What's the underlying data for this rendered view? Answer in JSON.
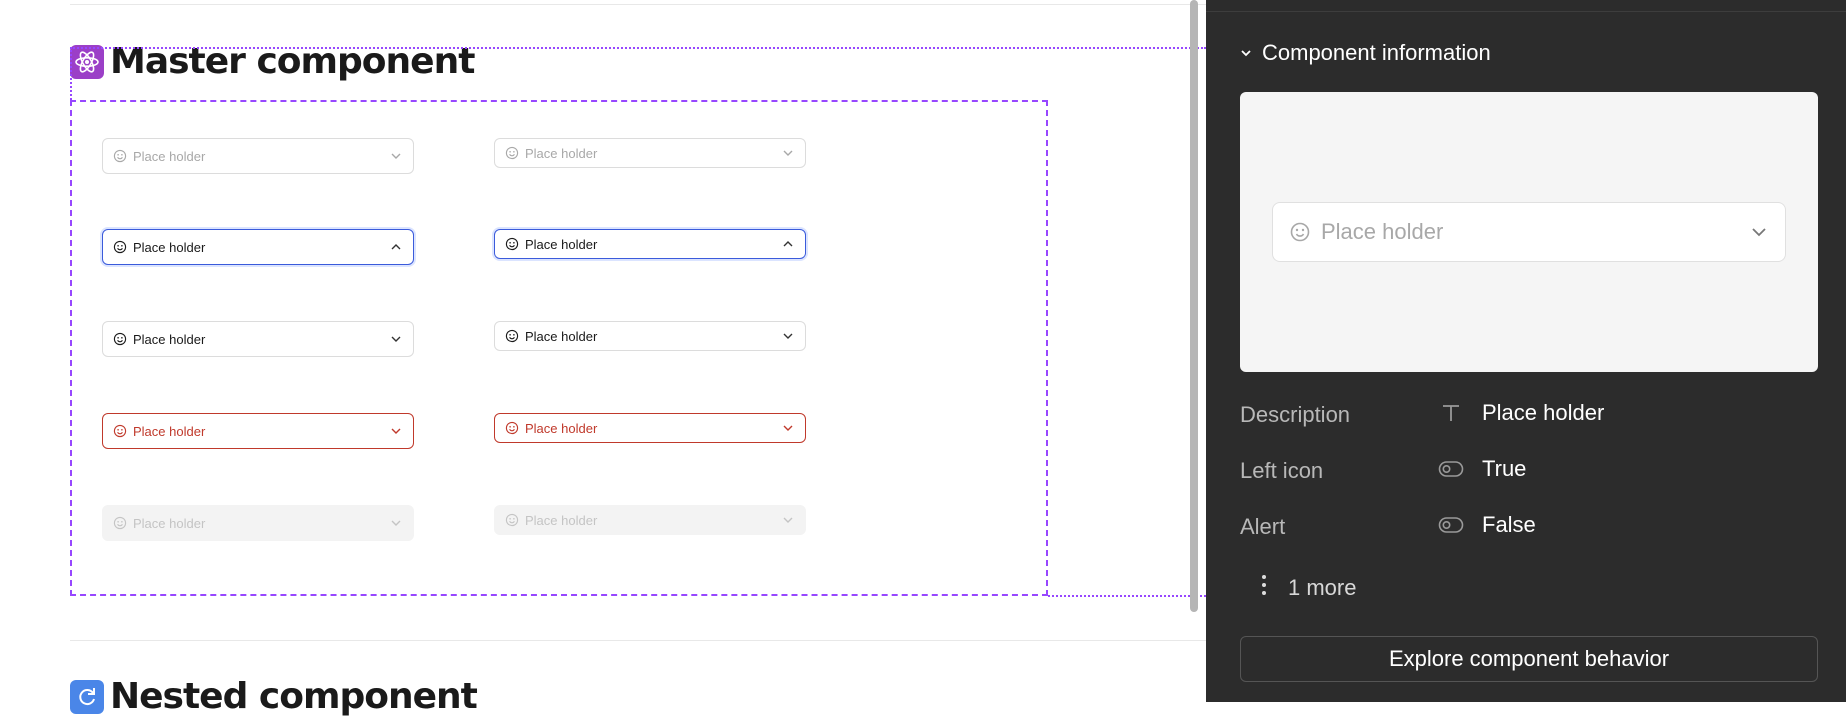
{
  "sections": {
    "master": {
      "emoji_icon": "atom-icon",
      "title": "Master component"
    },
    "nested": {
      "emoji_icon": "refresh-icon",
      "title": "Nested component"
    }
  },
  "variants": {
    "col_large": [
      {
        "state": "default",
        "label": "Place holder",
        "chevron": "down"
      },
      {
        "state": "focus",
        "label": "Place holder",
        "chevron": "up"
      },
      {
        "state": "filled",
        "label": "Place holder",
        "chevron": "down"
      },
      {
        "state": "error",
        "label": "Place holder",
        "chevron": "down"
      },
      {
        "state": "disabled",
        "label": "Place holder",
        "chevron": "down"
      }
    ],
    "col_small": [
      {
        "state": "default",
        "label": "Place holder",
        "chevron": "down"
      },
      {
        "state": "focus",
        "label": "Place holder",
        "chevron": "up"
      },
      {
        "state": "filled",
        "label": "Place holder",
        "chevron": "down"
      },
      {
        "state": "error",
        "label": "Place holder",
        "chevron": "down"
      },
      {
        "state": "disabled",
        "label": "Place holder",
        "chevron": "down"
      }
    ]
  },
  "panel": {
    "section_title": "Component information",
    "preview": {
      "label": "Place holder"
    },
    "properties": [
      {
        "name": "Description",
        "icon": "text-icon",
        "value": "Place holder"
      },
      {
        "name": "Left icon",
        "icon": "toggle-icon",
        "value": "True"
      },
      {
        "name": "Alert",
        "icon": "toggle-icon",
        "value": "False"
      }
    ],
    "more_label": "1 more",
    "explore_button": "Explore component behavior"
  },
  "colors": {
    "accent": "#9747ff",
    "focus": "#3b5bdb",
    "error": "#c0392b",
    "panel_bg": "#2c2c2c"
  }
}
